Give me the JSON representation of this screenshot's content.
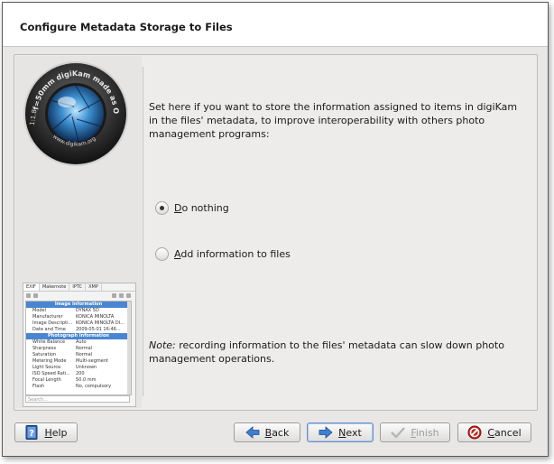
{
  "window": {
    "title": "Configure Metadata Storage to Files"
  },
  "logo": {
    "brand": "digiKam",
    "ring_text_top": "made as OPEN SOURCE",
    "ring_text_left": "f=50mm",
    "ring_text_side": "1:1.8",
    "ring_text_bottom": "www.digikam.org"
  },
  "thumbnail": {
    "tabs": [
      "EXIF",
      "Makernote",
      "IPTC",
      "XMP"
    ],
    "section1": "Image Information",
    "rows1": [
      {
        "k": "Model",
        "v": "DYNAX 5D"
      },
      {
        "k": "Manufacturer",
        "v": "KONICA MINOLTA"
      },
      {
        "k": "Image Descripti...",
        "v": "KONICA MINOLTA DI..."
      },
      {
        "k": "Date and Time",
        "v": "2009:05:01 16:46..."
      }
    ],
    "section2": "Photograph Information",
    "rows2": [
      {
        "k": "White Balance",
        "v": "Auto"
      },
      {
        "k": "Sharpness",
        "v": "Normal"
      },
      {
        "k": "Saturation",
        "v": "Normal"
      },
      {
        "k": "Metering Mode",
        "v": "Multi-segment"
      },
      {
        "k": "Light Source",
        "v": "Unknown"
      },
      {
        "k": "ISO Speed Rati...",
        "v": "200"
      },
      {
        "k": "Focal Length",
        "v": "50.0 mm"
      },
      {
        "k": "Flash",
        "v": "No, compulsory"
      }
    ],
    "search_placeholder": "Search..."
  },
  "content": {
    "description": "Set here if you want to store the information assigned to items in digiKam in the files' metadata, to improve interoperability with others photo management programs:",
    "options": [
      {
        "first": "D",
        "rest": "o nothing",
        "selected": true
      },
      {
        "first": "A",
        "rest": "dd information to files",
        "selected": false
      }
    ],
    "note_prefix": "Note:",
    "note_text": " recording information to the files' metadata can slow down photo management operations."
  },
  "buttons": {
    "help": {
      "u": "H",
      "rest": "elp"
    },
    "back": {
      "u": "B",
      "rest": "ack"
    },
    "next": {
      "u": "N",
      "rest": "ext"
    },
    "finish": {
      "u": "F",
      "rest": "inish"
    },
    "cancel": {
      "u": "C",
      "rest": "ancel"
    }
  },
  "colors": {
    "accent": "#4a86cf",
    "cancel_icon": "#c0261f",
    "help_icon": "#2b5fa8"
  }
}
